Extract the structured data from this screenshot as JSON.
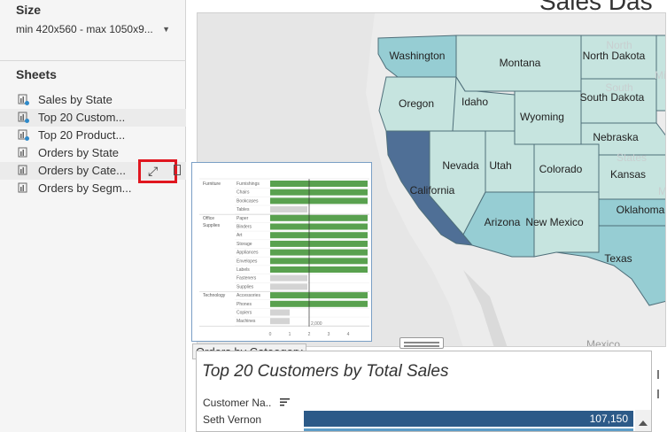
{
  "sidebar": {
    "size_title": "Size",
    "size_value": "min 420x560 - max 1050x9...",
    "sheets_title": "Sheets",
    "sheets": [
      {
        "label": "Sales by State"
      },
      {
        "label": "Top 20 Custom..."
      },
      {
        "label": "Top 20 Product..."
      },
      {
        "label": "Orders by State"
      },
      {
        "label": "Orders by Cate..."
      },
      {
        "label": "Orders by Segm..."
      }
    ]
  },
  "dashboard": {
    "title": "Sales Das",
    "map": {
      "states": [
        {
          "name": "Washington"
        },
        {
          "name": "Montana"
        },
        {
          "name": "North Dakota"
        },
        {
          "name": "Oregon"
        },
        {
          "name": "Idaho"
        },
        {
          "name": "Wyoming"
        },
        {
          "name": "South Dakota"
        },
        {
          "name": "Nebraska"
        },
        {
          "name": "Nevada"
        },
        {
          "name": "Utah"
        },
        {
          "name": "Colorado"
        },
        {
          "name": "Kansas"
        },
        {
          "name": "California"
        },
        {
          "name": "Arizona"
        },
        {
          "name": "New Mexico"
        },
        {
          "name": "Oklahoma"
        },
        {
          "name": "Texas"
        }
      ],
      "ghost_labels": [
        "North",
        "South",
        "Minn",
        "Mi",
        "States"
      ],
      "sea_label": "Mexico",
      "colors": {
        "light": "#c6e4df",
        "mid": "#96cdd3",
        "dark": "#4f6f96",
        "land": "#ececec",
        "water": "#e3e3e3"
      }
    },
    "category_chart": {
      "caption": "Orders by Cateogory",
      "groups": [
        {
          "name": "Furniture",
          "items": [
            "Furnishings",
            "Chairs",
            "Bookcases",
            "Tables"
          ]
        },
        {
          "name": "Office Supplies",
          "items": [
            "Paper",
            "Binders",
            "Art",
            "Storage",
            "Appliances",
            "Envelopes",
            "Labels",
            "Fasteners",
            "Supplies"
          ]
        },
        {
          "name": "Technology",
          "items": [
            "Accessories",
            "Phones",
            "Copiers",
            "Machines"
          ]
        }
      ],
      "reference_label": "2,000",
      "ticks": [
        "0",
        "1",
        "2",
        "3",
        "4"
      ],
      "colors": {
        "above": "#59a14f",
        "below": "#d3d3d3",
        "ref_line": "#333333"
      }
    },
    "top_customers": {
      "title": "Top 20 Customers by Total Sales",
      "column_header": "Customer Na..",
      "rows": [
        {
          "name": "Seth Vernon",
          "value": "107,150"
        }
      ]
    }
  }
}
